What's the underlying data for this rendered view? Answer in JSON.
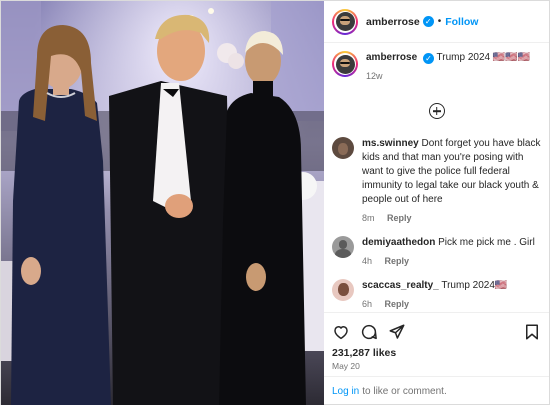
{
  "post": {
    "username": "amberrose",
    "follow_label": "Follow",
    "separator": "•",
    "caption": {
      "username": "amberrose",
      "text": "Trump 2024 🇺🇸🇺🇸🇺🇸",
      "age": "12w"
    },
    "comments": [
      {
        "username": "ms.swinney",
        "text": "Dont forget you have black kids and that man you're posing with want to give the police full federal immunity to legal take our black youth & people out of here",
        "age": "8m",
        "reply_label": "Reply"
      },
      {
        "username": "demiyaathedon",
        "text": "Pick me pick me . Girl",
        "age": "4h",
        "reply_label": "Reply"
      },
      {
        "username": "scaccas_realty_",
        "text": "Trump 2024🇺🇸",
        "age": "6h",
        "reply_label": "Reply"
      }
    ],
    "likes": "231,287 likes",
    "date": "May 20",
    "login": {
      "link": "Log in",
      "text": "to like or comment."
    }
  },
  "icons": [
    "verified-badge-icon",
    "load-more-plus-icon",
    "heart-icon",
    "comment-icon",
    "share-icon",
    "bookmark-icon"
  ],
  "colors": {
    "accent": "#0095f6",
    "text": "#262626",
    "muted": "#737373",
    "border": "#dbdbdb"
  }
}
